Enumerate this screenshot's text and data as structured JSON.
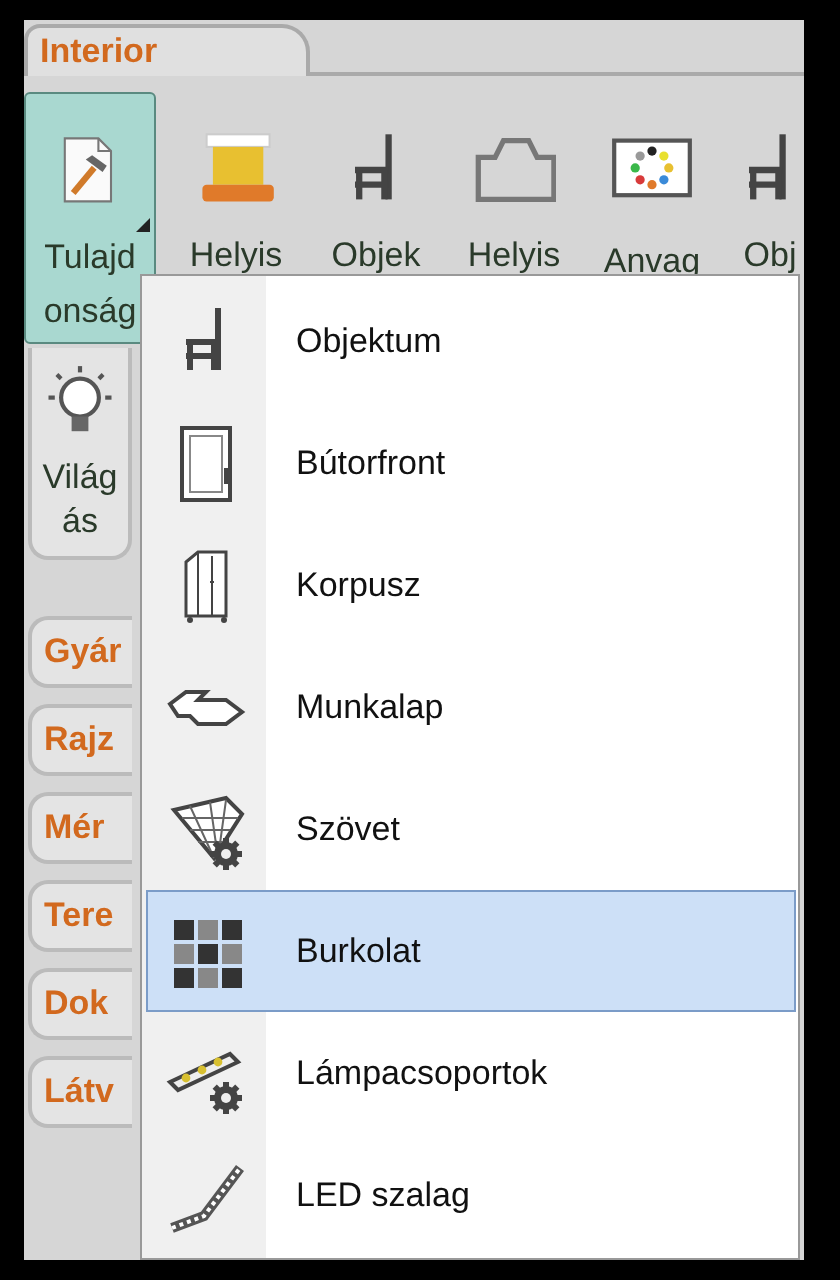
{
  "ribbon": {
    "tab": {
      "label": "Interior",
      "selected": true
    },
    "buttons": [
      {
        "kind": "properties",
        "lines": [
          "Tulajd",
          "onság"
        ],
        "selected": true,
        "dropdown": true
      },
      {
        "kind": "room",
        "lines": [
          "Helyis"
        ],
        "selected": false,
        "dropdown": false
      },
      {
        "kind": "chair",
        "lines": [
          "Objek"
        ],
        "selected": false,
        "dropdown": false
      },
      {
        "kind": "room-outline",
        "lines": [
          "Helyis"
        ],
        "selected": false,
        "dropdown": false
      },
      {
        "kind": "palette",
        "lines": [
          "Anvag"
        ],
        "selected": false,
        "dropdown": false
      },
      {
        "kind": "chair",
        "lines": [
          "Obj"
        ],
        "selected": false,
        "dropdown": false
      }
    ]
  },
  "side": {
    "big_button": {
      "kind": "bulb",
      "lines": [
        "Világ",
        "ás"
      ]
    },
    "tabs": [
      "Gyár",
      "Rajz",
      "Mér",
      "Tere",
      "Dok",
      "Látv"
    ]
  },
  "menu": {
    "items": [
      {
        "kind": "chair",
        "label": "Objektum",
        "selected": false
      },
      {
        "kind": "door",
        "label": "Bútorfront",
        "selected": false
      },
      {
        "kind": "cabinet",
        "label": "Korpusz",
        "selected": false
      },
      {
        "kind": "worktop",
        "label": "Munkalap",
        "selected": false
      },
      {
        "kind": "mesh",
        "label": "Szövet",
        "selected": false
      },
      {
        "kind": "tiles",
        "label": "Burkolat",
        "selected": true
      },
      {
        "kind": "lamp",
        "label": "Lámpacsoportok",
        "selected": false
      },
      {
        "kind": "led",
        "label": "LED szalag",
        "selected": false
      }
    ]
  }
}
